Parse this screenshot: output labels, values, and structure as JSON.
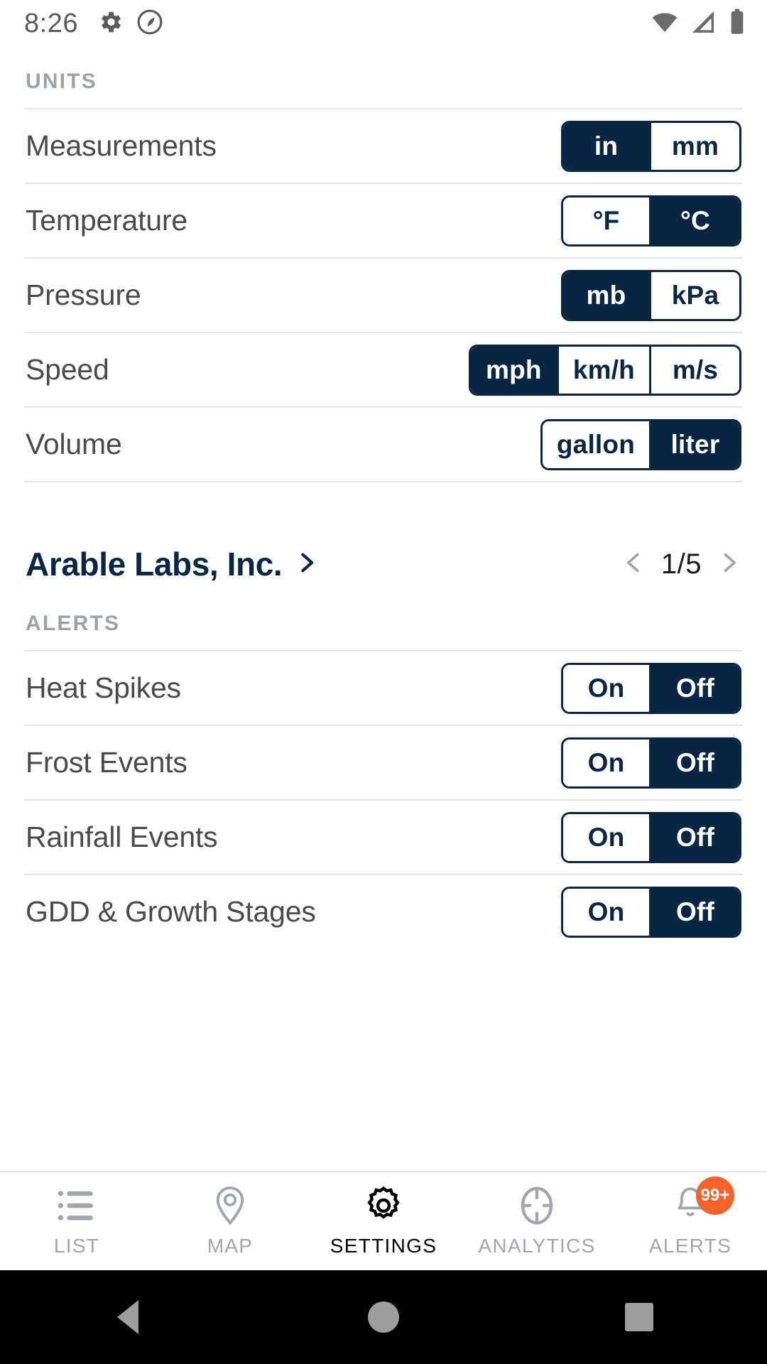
{
  "status_bar": {
    "time": "8:26",
    "left_icons": [
      "gear-icon",
      "arable-logo-icon"
    ],
    "right_icons": [
      "wifi-icon",
      "cellular-signal-icon",
      "battery-icon"
    ]
  },
  "units_section": {
    "header": "UNITS",
    "rows": [
      {
        "label": "Measurements",
        "options": [
          "in",
          "mm"
        ],
        "selected": "in"
      },
      {
        "label": "Temperature",
        "options": [
          "°F",
          "°C"
        ],
        "selected": "°C"
      },
      {
        "label": "Pressure",
        "options": [
          "mb",
          "kPa"
        ],
        "selected": "mb"
      },
      {
        "label": "Speed",
        "options": [
          "mph",
          "km/h",
          "m/s"
        ],
        "selected": "mph"
      },
      {
        "label": "Volume",
        "options": [
          "gallon",
          "liter"
        ],
        "selected": "liter"
      }
    ]
  },
  "organization": {
    "name": "Arable Labs, Inc.",
    "chevron": "chevron-right-icon",
    "pager": {
      "prev": "chevron-left-icon",
      "label": "1/5",
      "next": "chevron-right-icon"
    }
  },
  "alerts_section": {
    "header": "ALERTS",
    "rows": [
      {
        "label": "Heat Spikes",
        "options": [
          "On",
          "Off"
        ],
        "selected": "Off"
      },
      {
        "label": "Frost Events",
        "options": [
          "On",
          "Off"
        ],
        "selected": "Off"
      },
      {
        "label": "Rainfall Events",
        "options": [
          "On",
          "Off"
        ],
        "selected": "Off"
      },
      {
        "label": "GDD & Growth Stages",
        "options": [
          "On",
          "Off"
        ],
        "selected": "Off"
      }
    ]
  },
  "bottom_nav": {
    "items": [
      {
        "label": "LIST",
        "icon": "list-icon",
        "active": false
      },
      {
        "label": "MAP",
        "icon": "map-pin-icon",
        "active": false
      },
      {
        "label": "SETTINGS",
        "icon": "gear-icon",
        "active": true
      },
      {
        "label": "ANALYTICS",
        "icon": "target-icon",
        "active": false
      },
      {
        "label": "ALERTS",
        "icon": "bell-icon",
        "active": false,
        "badge": "99+"
      }
    ]
  },
  "android_nav": {
    "back": "back-triangle-icon",
    "home": "home-circle-icon",
    "recents": "recents-square-icon"
  },
  "colors": {
    "navy": "#0b2545",
    "gray_text": "#9aa3ab",
    "row_text": "#4a4a4a",
    "badge_orange": "#f4612a",
    "divider": "#e4e6e8"
  }
}
